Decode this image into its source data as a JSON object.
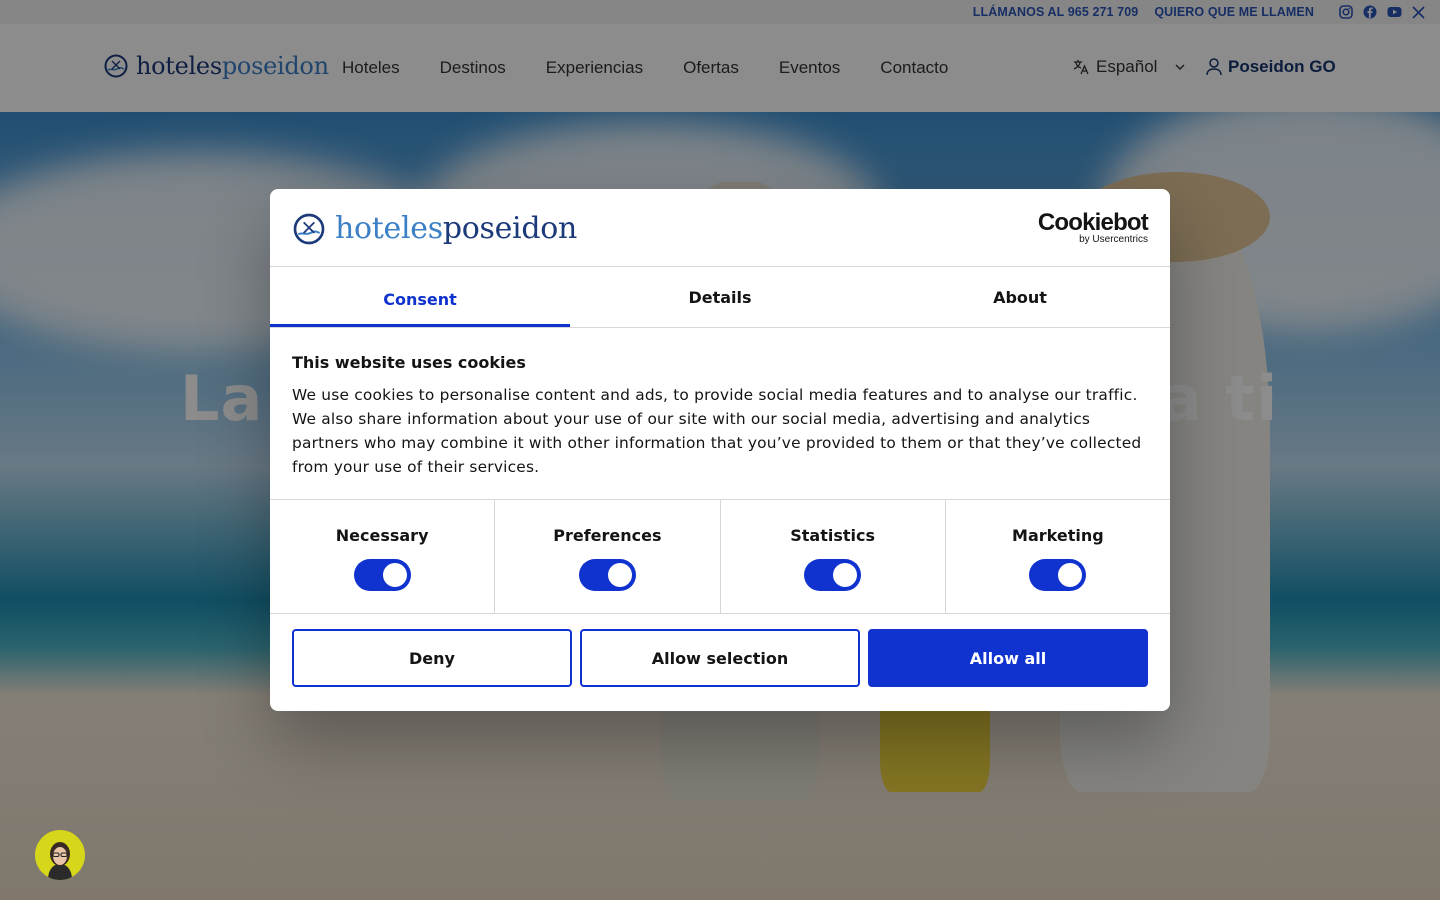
{
  "topbar": {
    "call_label": "LLÁMANOS AL 965 271 709",
    "callback_label": "QUIERO QUE ME LLAMEN",
    "social_icons": [
      "instagram-icon",
      "facebook-icon",
      "youtube-icon",
      "x-icon"
    ]
  },
  "header": {
    "logo_part1": "hoteles",
    "logo_part2": "poseidon",
    "nav": [
      "Hoteles",
      "Destinos",
      "Experiencias",
      "Ofertas",
      "Eventos",
      "Contacto"
    ],
    "language": "Español",
    "account_label": "Poseidon GO"
  },
  "hero": {
    "title_left": "La",
    "title_right": "a ti"
  },
  "consent": {
    "logo_part1": "hoteles",
    "logo_part2": "poseidon",
    "brand_main": "Cookiebot",
    "brand_sub": "by Usercentrics",
    "tabs": [
      "Consent",
      "Details",
      "About"
    ],
    "active_tab": "Consent",
    "heading": "This website uses cookies",
    "text": "We use cookies to personalise content and ads, to provide social media features and to analyse our traffic. We also share information about your use of our site with our social media, advertising and analytics partners who may combine it with other information that you’ve provided to them or that they’ve collected from your use of their services.",
    "categories": [
      {
        "label": "Necessary",
        "enabled": true
      },
      {
        "label": "Preferences",
        "enabled": true
      },
      {
        "label": "Statistics",
        "enabled": true
      },
      {
        "label": "Marketing",
        "enabled": true
      }
    ],
    "deny_label": "Deny",
    "allow_selection_label": "Allow selection",
    "allow_all_label": "Allow all"
  },
  "colors": {
    "accent": "#1032cf",
    "brand_dark": "#1c3a7a",
    "brand_light": "#3b7fc6",
    "topbar_link": "#2a55b8",
    "chat_avatar_bg": "#d6d61a"
  }
}
